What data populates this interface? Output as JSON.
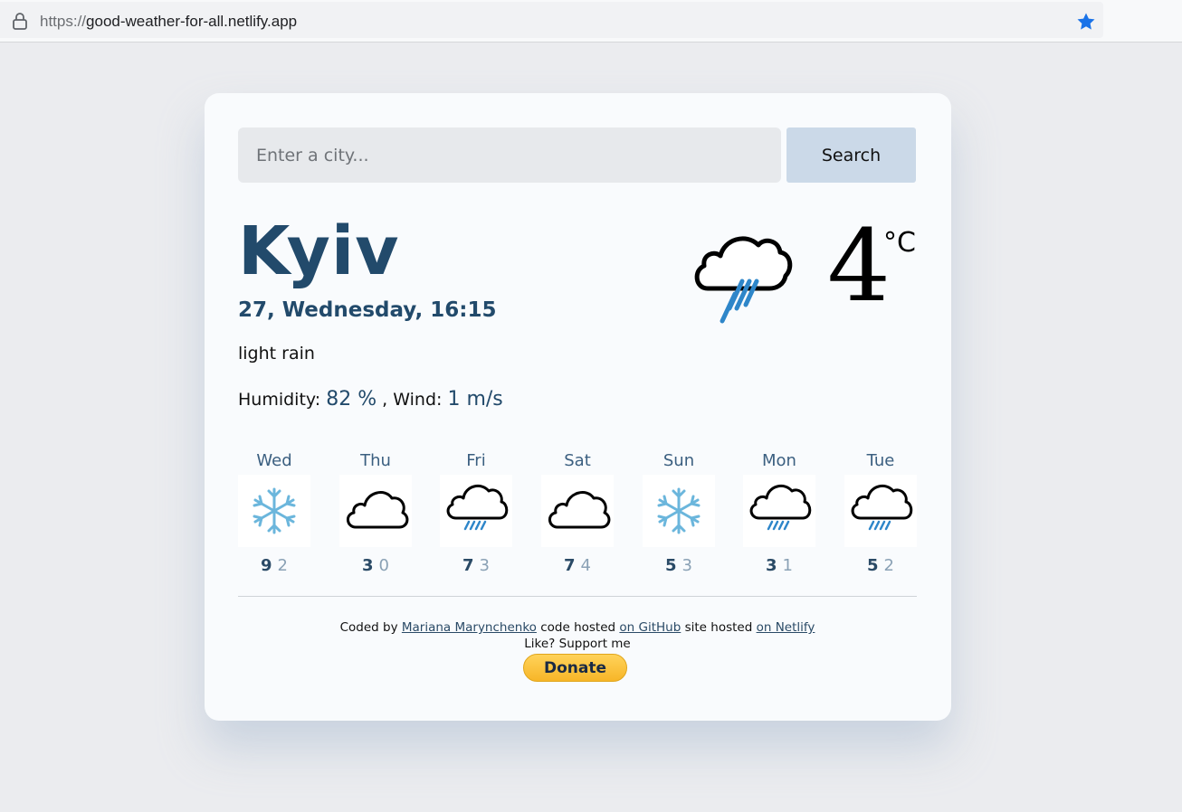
{
  "browser": {
    "url_protocol": "https://",
    "url_host": "good-weather-for-all.netlify.app",
    "accent": "#1a73e8"
  },
  "search": {
    "placeholder": "Enter a city...",
    "button_label": "Search"
  },
  "current": {
    "city": "Kyiv",
    "date": "27, Wednesday, 16:15",
    "description": "light rain",
    "humidity_label": "Humidity:",
    "humidity_value": "82 %",
    "wind_label": ", Wind:",
    "wind_value": "1 m/s",
    "temperature": "4",
    "unit": "°C",
    "icon": "rain-cloud-icon"
  },
  "forecast": [
    {
      "day": "Wed",
      "icon": "snowflake-icon",
      "max": "9",
      "min": "2"
    },
    {
      "day": "Thu",
      "icon": "cloud-icon",
      "max": "3",
      "min": "0"
    },
    {
      "day": "Fri",
      "icon": "rain-cloud-icon",
      "max": "7",
      "min": "3"
    },
    {
      "day": "Sat",
      "icon": "cloud-icon",
      "max": "7",
      "min": "4"
    },
    {
      "day": "Sun",
      "icon": "snowflake-icon",
      "max": "5",
      "min": "3"
    },
    {
      "day": "Mon",
      "icon": "rain-cloud-icon",
      "max": "3",
      "min": "1"
    },
    {
      "day": "Tue",
      "icon": "rain-cloud-icon",
      "max": "5",
      "min": "2"
    }
  ],
  "footer": {
    "coded_by": "Coded by",
    "author_link": "Mariana Marynchenko",
    "code_hosted": "code hosted",
    "github_link": "on GitHub",
    "site_hosted": "site hosted",
    "netlify_link": "on Netlify",
    "support": "Like? Support me",
    "donate_label": "Donate"
  },
  "colors": {
    "primary": "#224a6b",
    "rain": "#2e86c9",
    "snow": "#6bb6dc"
  }
}
